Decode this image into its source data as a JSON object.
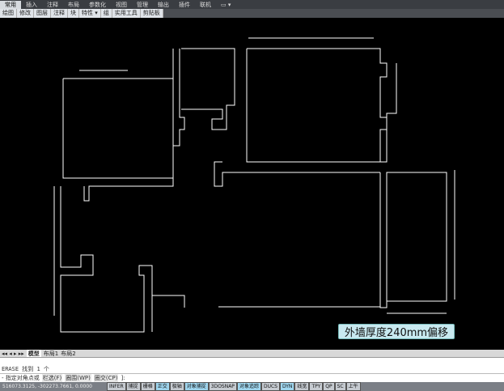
{
  "menu": [
    "常用",
    "插入",
    "注释",
    "布局",
    "参数化",
    "视图",
    "管理",
    "输出",
    "插件",
    "联机",
    "▭ ▾"
  ],
  "ribbon": [
    "绘图",
    "修改",
    "图层",
    "注释",
    "块",
    "特性 ▾",
    "组",
    "实用工具",
    "剪贴板"
  ],
  "tabs": {
    "nav": "◂◂ ◂ ▸ ▸▸",
    "items": [
      "模型",
      "布局1",
      "布局2"
    ]
  },
  "command": {
    "history": "ERASE 找到 1 个",
    "prompt": "- 指定对角点或",
    "options": [
      "栏选(F)",
      "圈围(WP)",
      "圈交(CP)"
    ],
    "suffix": "]:"
  },
  "status": {
    "coords": "516073.3125, -302273.7661, 0.0000",
    "buttons": [
      {
        "label": "INFER",
        "on": false
      },
      {
        "label": "捕捉",
        "on": false
      },
      {
        "label": "栅格",
        "on": false
      },
      {
        "label": "正交",
        "on": true
      },
      {
        "label": "极轴",
        "on": false
      },
      {
        "label": "对象捕捉",
        "on": true
      },
      {
        "label": "3DOSNAP",
        "on": false
      },
      {
        "label": "对象追踪",
        "on": true
      },
      {
        "label": "DUCS",
        "on": false
      },
      {
        "label": "DYN",
        "on": true
      },
      {
        "label": "线宽",
        "on": false
      },
      {
        "label": "TPY",
        "on": false
      },
      {
        "label": "QP",
        "on": false
      },
      {
        "label": "SC",
        "on": false
      },
      {
        "label": "上午",
        "on": false
      }
    ]
  },
  "annotation": "外墙厚度240mm偏移"
}
